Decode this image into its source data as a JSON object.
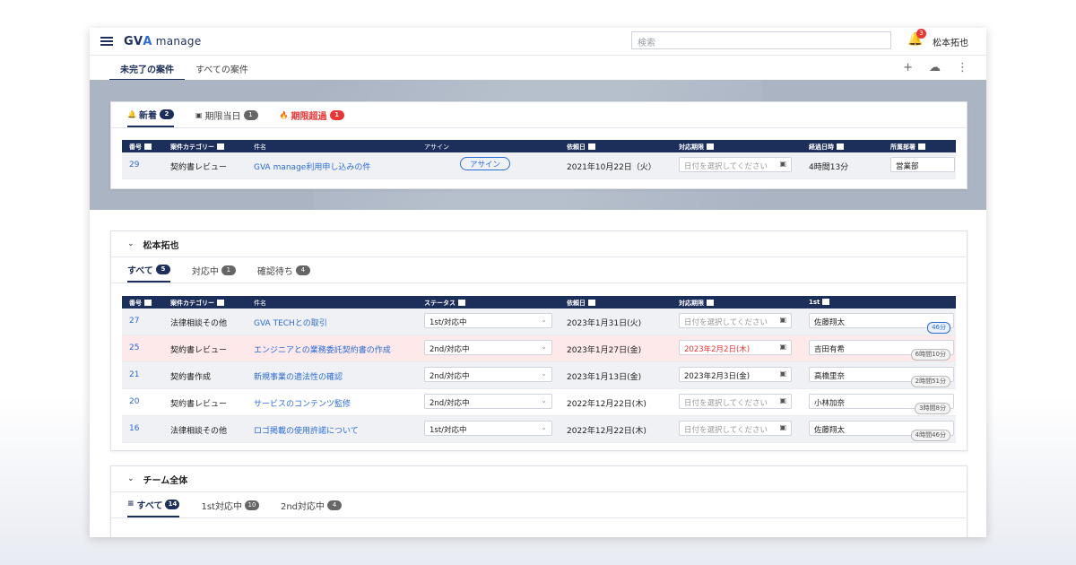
{
  "app": {
    "logo_main": "GV",
    "logo_accent": "A",
    "logo_sub": "manage"
  },
  "topbar": {
    "search_placeholder": "検索",
    "notif_count": "3",
    "user_name": "松本拓也"
  },
  "main_tabs": [
    {
      "label": "未完了の案件",
      "active": true
    },
    {
      "label": "すべての案件",
      "active": false
    }
  ],
  "actions": {
    "add": "+",
    "cloud": "☁",
    "more": "⋮"
  },
  "new_card": {
    "tabs": [
      {
        "label": "新着",
        "count": "2",
        "icon": "🔔"
      },
      {
        "label": "期限当日",
        "count": "1",
        "icon": "▣"
      },
      {
        "label": "期限超過",
        "count": "1",
        "icon": "🔥"
      }
    ],
    "headers": [
      "番号",
      "案件カテゴリー",
      "件名",
      "アサイン",
      "依頼日",
      "対応期限",
      "経過日時",
      "所属部署"
    ],
    "row": {
      "no": "29",
      "category": "契約書レビュー",
      "title": "GVA manage利用申し込みの件",
      "assign": "アサイン",
      "date": "2021年10月22日（火）",
      "deadline": "日付を選択してください",
      "elapsed": "4時間13分",
      "dept": "営業部"
    }
  },
  "my_card": {
    "title": "松本拓也",
    "tabs": [
      {
        "label": "すべて",
        "count": "5"
      },
      {
        "label": "対応中",
        "count": "1"
      },
      {
        "label": "確認待ち",
        "count": "4"
      }
    ],
    "headers": [
      "番号",
      "案件カテゴリー",
      "件名",
      "ステータス",
      "依頼日",
      "対応期限",
      "1st"
    ],
    "rows": [
      {
        "no": "27",
        "category": "法律相談その他",
        "title": "GVA TECHとの取引",
        "status": "1st/対応中",
        "date": "2023年1月31日(火)",
        "deadline": "日付を選択してください",
        "person": "佐藤翔太",
        "timer": "46分"
      },
      {
        "no": "25",
        "category": "契約書レビュー",
        "title": "エンジニアとの業務委託契約書の作成",
        "status": "2nd/対応中",
        "date": "2023年1月27日(金)",
        "deadline": "2023年2月2日(木)",
        "person": "吉田有希",
        "timer": "6時間10分"
      },
      {
        "no": "21",
        "category": "契約書作成",
        "title": "新規事業の適法性の確認",
        "status": "2nd/対応中",
        "date": "2023年1月13日(金)",
        "deadline": "2023年2月3日(金)",
        "person": "高橋里奈",
        "timer": "2時間51分"
      },
      {
        "no": "20",
        "category": "契約書レビュー",
        "title": "サービスのコンテンツ監修",
        "status": "2nd/対応中",
        "date": "2022年12月22日(木)",
        "deadline": "日付を選択してください",
        "person": "小林加奈",
        "timer": "3時間8分"
      },
      {
        "no": "16",
        "category": "法律相談その他",
        "title": "ロゴ掲載の使用許諾について",
        "status": "1st/対応中",
        "date": "2022年12月22日(木)",
        "deadline": "日付を選択してください",
        "person": "佐藤翔太",
        "timer": "4時間46分"
      }
    ]
  },
  "team_card": {
    "title": "チーム全体",
    "tabs": [
      {
        "label": "すべて",
        "count": "14"
      },
      {
        "label": "1st対応中",
        "count": "10"
      },
      {
        "label": "2nd対応中",
        "count": "4"
      }
    ]
  }
}
